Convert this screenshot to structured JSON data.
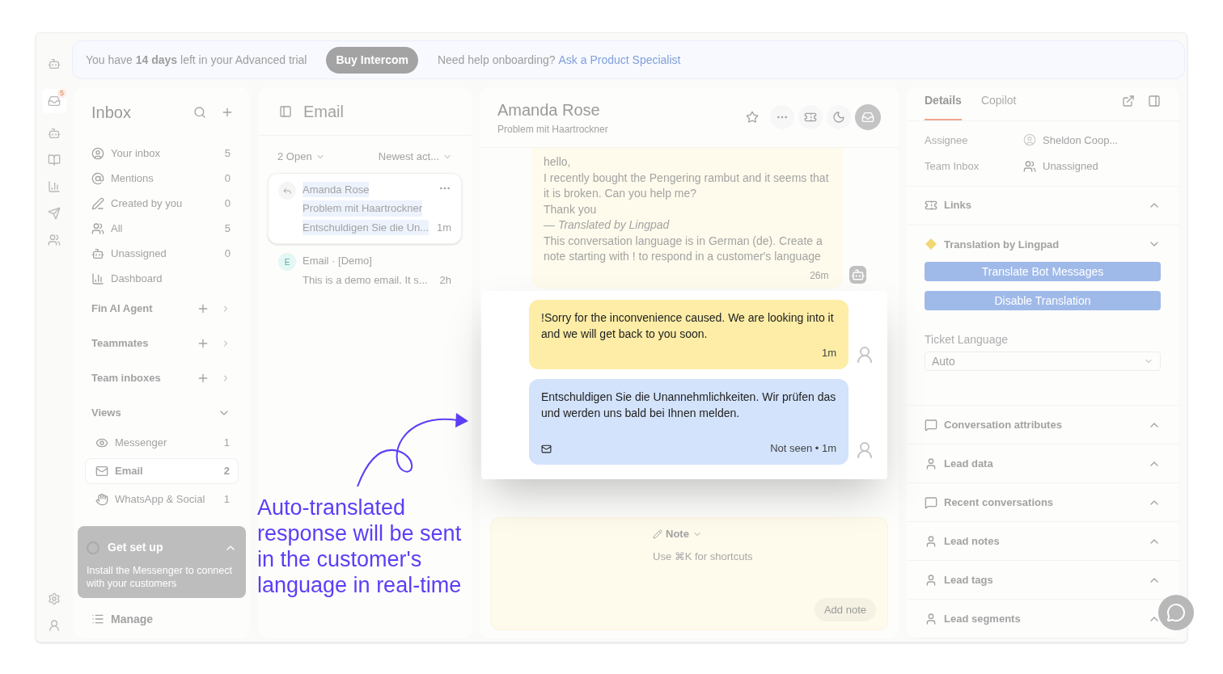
{
  "banner": {
    "text": "You have **14 days** left in your Advanced trial",
    "button": "Buy Intercom",
    "help": "Need help onboarding?",
    "link": "Ask a Product Specialist"
  },
  "rail": {
    "badge": "5"
  },
  "inbox": {
    "title": "Inbox",
    "items": [
      {
        "label": "Your inbox",
        "count": "5"
      },
      {
        "label": "Mentions",
        "count": "0"
      },
      {
        "label": "Created by you",
        "count": "0"
      },
      {
        "label": "All",
        "count": "5"
      },
      {
        "label": "Unassigned",
        "count": "0"
      },
      {
        "label": "Dashboard"
      }
    ],
    "sections": [
      {
        "label": "Fin AI Agent"
      },
      {
        "label": "Teammates"
      },
      {
        "label": "Team inboxes"
      }
    ],
    "views": {
      "label": "Views",
      "items": [
        {
          "label": "Messenger",
          "count": "1",
          "selected": false
        },
        {
          "label": "Email",
          "count": "2",
          "selected": true
        },
        {
          "label": "WhatsApp & Social",
          "count": "1",
          "selected": false
        }
      ]
    },
    "manage": "Manage"
  },
  "get_set_up": {
    "title": "Get set up",
    "text": "Install the Messenger to connect with your customers"
  },
  "list": {
    "title": "Email",
    "filter": "2 Open",
    "sort": "Newest act...",
    "items": [
      {
        "name": "Amanda Rose",
        "subject": "Problem mit Haartrockner",
        "preview": "Entschuldigen Sie die Un...",
        "time": "1m",
        "selected": true
      },
      {
        "avatar": "E",
        "name": "Email · [Demo]",
        "preview": "This is a demo email. It s...",
        "time": "2h",
        "selected": false
      }
    ]
  },
  "conversation": {
    "name": "Amanda Rose",
    "subject": "Problem mit Haartrockner",
    "message": {
      "text": "hello,\nI recently bought the Pengering rambut and it seems that it is broken. Can you help me?\nThank you\n*— Translated by Lingpad*\nThis conversation language is in German (de). Create a note starting with ! to respond in a customer's language",
      "time": "26m"
    },
    "composer": {
      "mode": "Note",
      "placeholder": "Use ⌘K for shortcuts",
      "button": "Add note"
    }
  },
  "popup": {
    "replies": [
      {
        "kind": "note",
        "text": "!Sorry for the inconvenience caused. We are looking into it and we will get back to you soon.",
        "time": "1m"
      },
      {
        "kind": "reply",
        "text": "Entschuldigen Sie die Unannehmlichkeiten. Wir prüfen das und werden uns bald bei Ihnen melden.",
        "time": "Not seen • 1m"
      }
    ]
  },
  "annotation": "Auto-translated response\nwill be sent in the customer's\nlanguage in real-time",
  "details": {
    "tabs": [
      {
        "label": "Details",
        "selected": true
      },
      {
        "label": "Copilot",
        "selected": false
      }
    ],
    "fields": [
      {
        "label": "Assignee",
        "value": "Sheldon Coop..."
      },
      {
        "label": "Team Inbox",
        "value": "Unassigned"
      }
    ],
    "translation": {
      "title": "Translation by Lingpad",
      "expanded": true,
      "buttons": [
        "Translate Bot Messages",
        "Disable Translation"
      ],
      "language_label": "Ticket Language",
      "language": "Auto"
    },
    "sections": [
      {
        "label": "Links",
        "expanded": false
      },
      {
        "label": "Conversation attributes",
        "expanded": false
      },
      {
        "label": "Lead data",
        "expanded": false
      },
      {
        "label": "Recent conversations",
        "expanded": false
      },
      {
        "label": "Lead notes",
        "expanded": false
      },
      {
        "label": "Lead tags",
        "expanded": false
      },
      {
        "label": "Lead segments",
        "expanded": false
      }
    ]
  }
}
